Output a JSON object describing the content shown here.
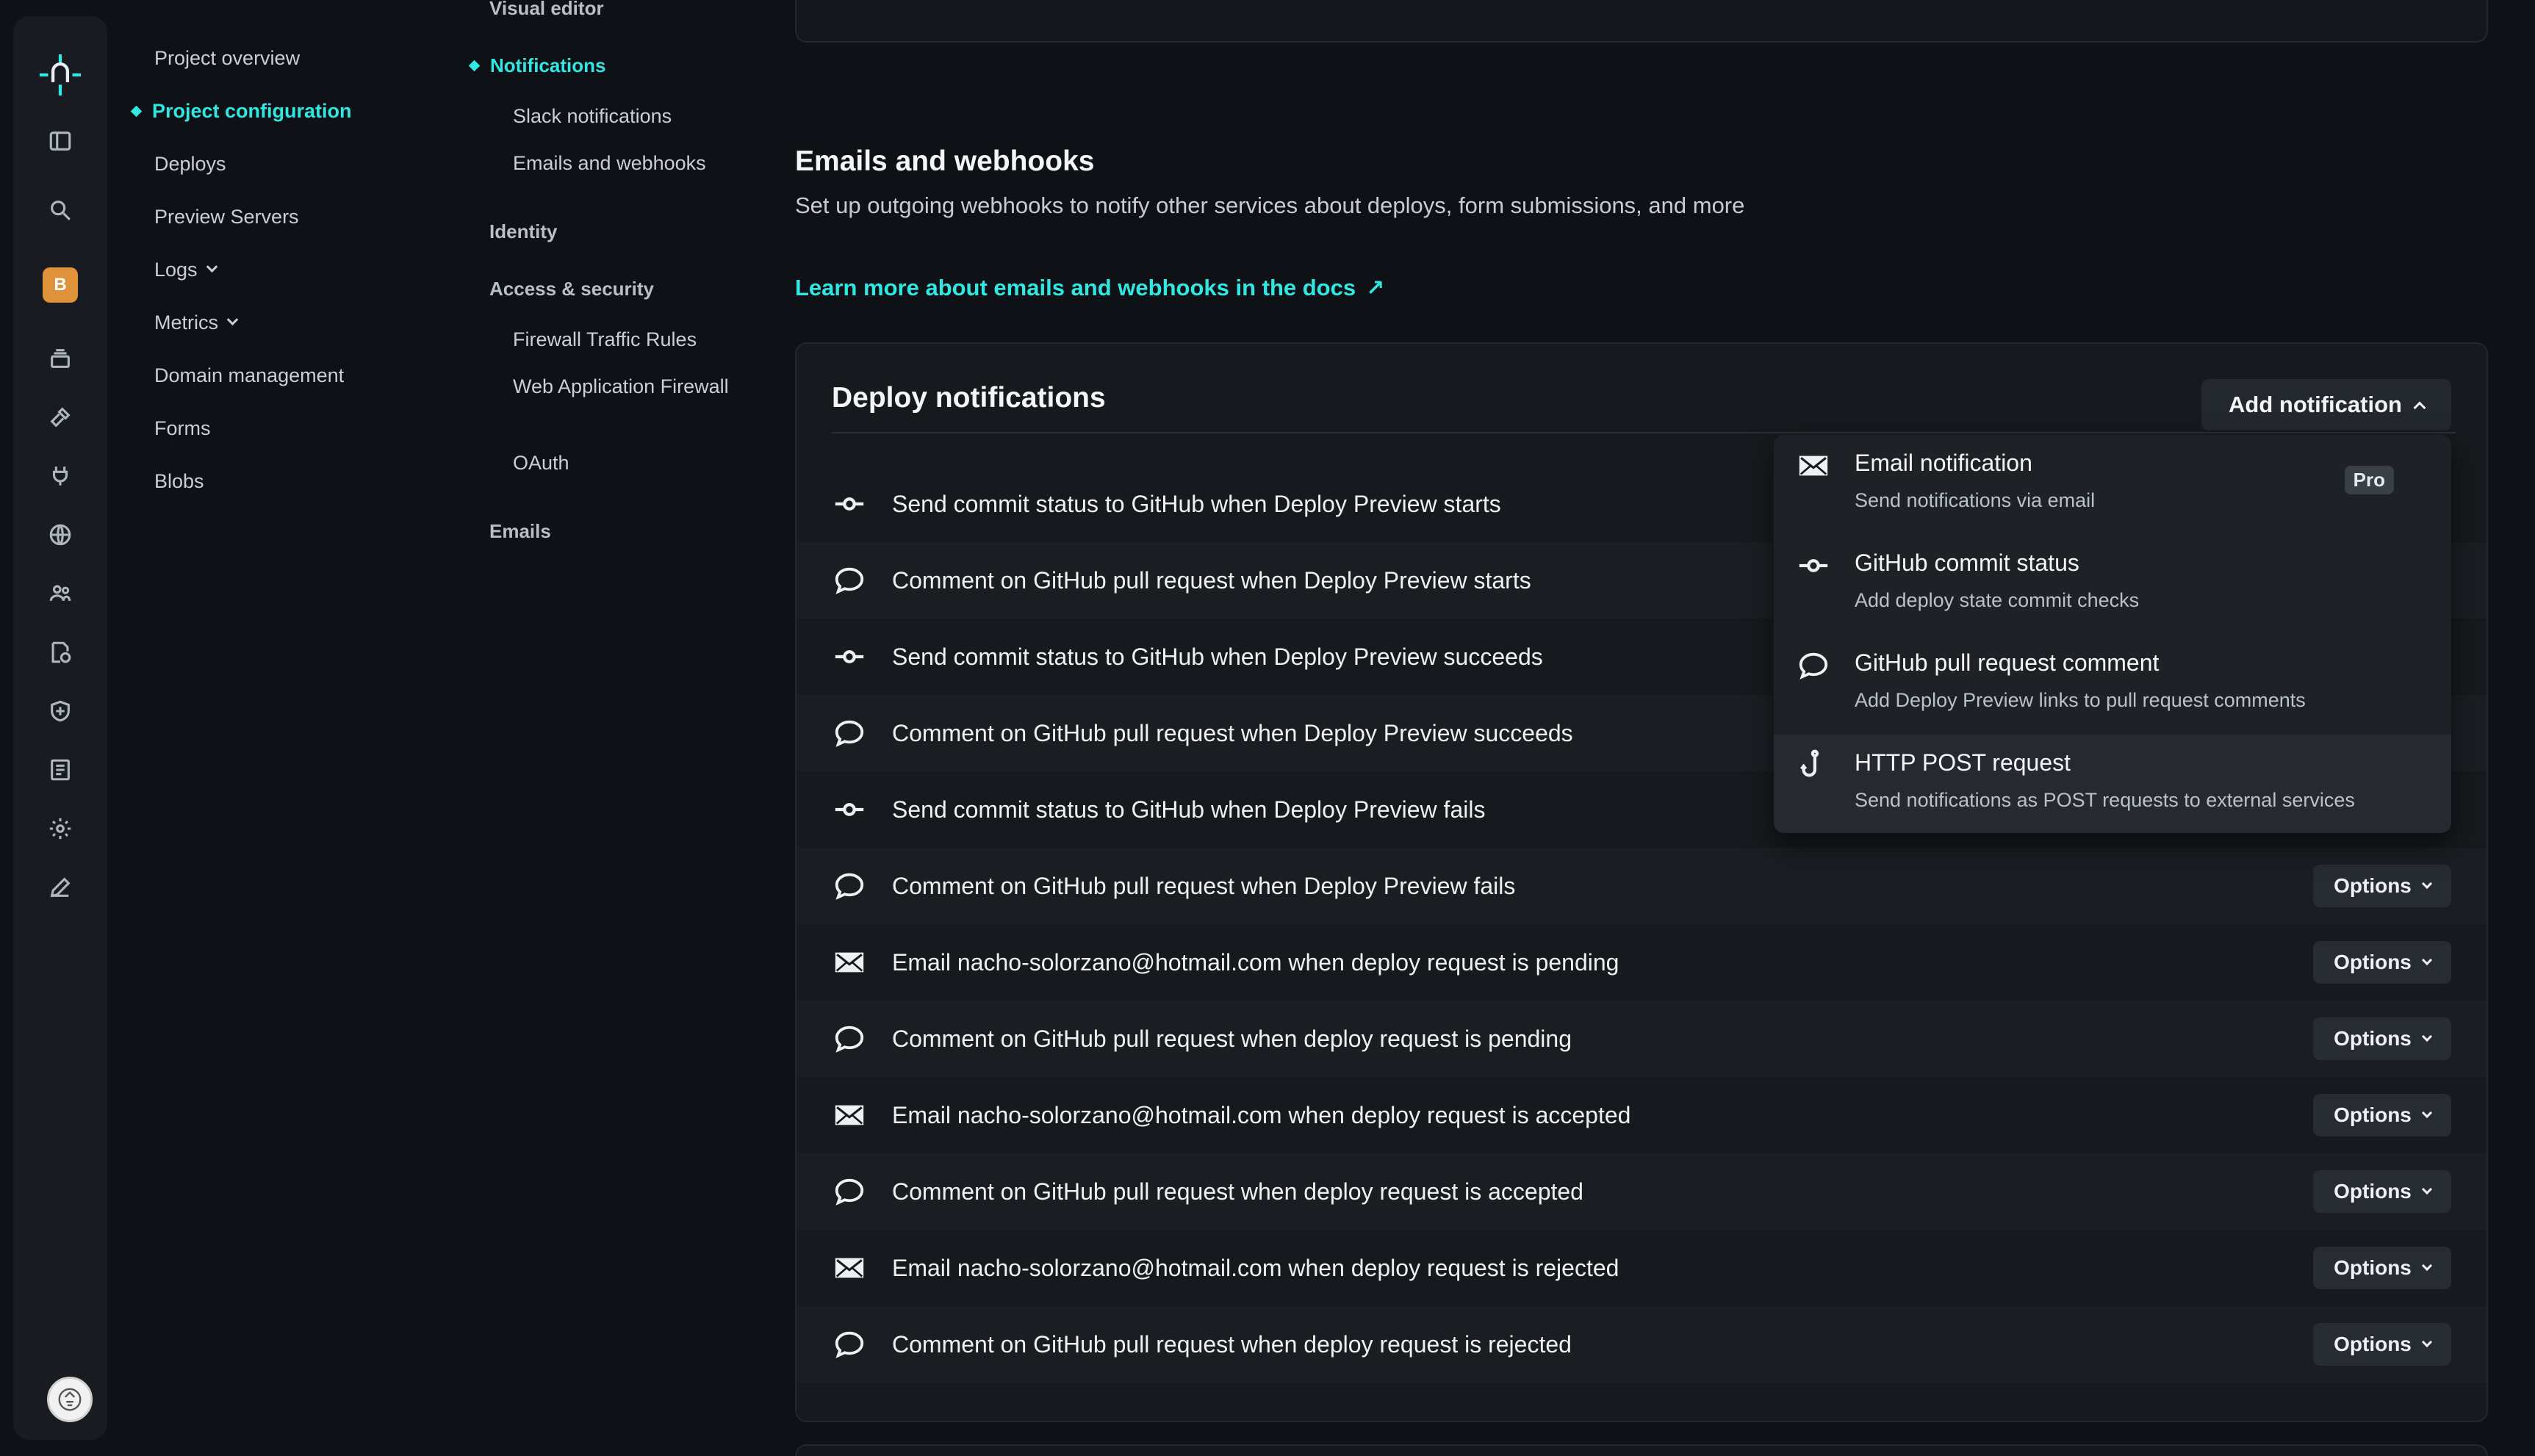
{
  "nav_primary": [
    {
      "label": "Project overview",
      "active": false,
      "chevron": false
    },
    {
      "label": "Project configuration",
      "active": true,
      "chevron": false
    },
    {
      "label": "Deploys",
      "active": false,
      "chevron": false
    },
    {
      "label": "Preview Servers",
      "active": false,
      "chevron": false
    },
    {
      "label": "Logs",
      "active": false,
      "chevron": true
    },
    {
      "label": "Metrics",
      "active": false,
      "chevron": true
    },
    {
      "label": "Domain management",
      "active": false,
      "chevron": false
    },
    {
      "label": "Forms",
      "active": false,
      "chevron": false
    },
    {
      "label": "Blobs",
      "active": false,
      "chevron": false
    }
  ],
  "nav_secondary": {
    "visual_editor": "Visual editor",
    "notifications": "Notifications",
    "slack": "Slack notifications",
    "emails_webhooks": "Emails and webhooks",
    "identity": "Identity",
    "access_security": "Access & security",
    "firewall": "Firewall Traffic Rules",
    "waf": "Web Application Firewall",
    "oauth": "OAuth",
    "emails": "Emails"
  },
  "team_badge": "B",
  "section": {
    "title": "Emails and webhooks",
    "description": "Set up outgoing webhooks to notify other services about deploys, form submissions, and more",
    "link": "Learn more about emails and webhooks in the docs",
    "link_arrow": "↗"
  },
  "card": {
    "title": "Deploy notifications",
    "add_button": "Add notification",
    "options_label": "Options"
  },
  "rows": [
    {
      "icon": "commit",
      "text": "Send commit status to GitHub when Deploy Preview starts",
      "has_options": false
    },
    {
      "icon": "comment",
      "text": "Comment on GitHub pull request when Deploy Preview starts",
      "has_options": false
    },
    {
      "icon": "commit",
      "text": "Send commit status to GitHub when Deploy Preview succeeds",
      "has_options": false
    },
    {
      "icon": "comment",
      "text": "Comment on GitHub pull request when Deploy Preview succeeds",
      "has_options": false
    },
    {
      "icon": "commit",
      "text": "Send commit status to GitHub when Deploy Preview fails",
      "has_options": false
    },
    {
      "icon": "comment",
      "text": "Comment on GitHub pull request when Deploy Preview fails",
      "has_options": true
    },
    {
      "icon": "email",
      "text": "Email nacho-solorzano@hotmail.com when deploy request is pending",
      "has_options": true
    },
    {
      "icon": "comment",
      "text": "Comment on GitHub pull request when deploy request is pending",
      "has_options": true
    },
    {
      "icon": "email",
      "text": "Email nacho-solorzano@hotmail.com when deploy request is accepted",
      "has_options": true
    },
    {
      "icon": "comment",
      "text": "Comment on GitHub pull request when deploy request is accepted",
      "has_options": true
    },
    {
      "icon": "email",
      "text": "Email nacho-solorzano@hotmail.com when deploy request is rejected",
      "has_options": true
    },
    {
      "icon": "comment",
      "text": "Comment on GitHub pull request when deploy request is rejected",
      "has_options": true
    }
  ],
  "dropdown": [
    {
      "icon": "email",
      "title": "Email notification",
      "desc": "Send notifications via email",
      "badge": "Pro"
    },
    {
      "icon": "commit",
      "title": "GitHub commit status",
      "desc": "Add deploy state commit checks",
      "badge": ""
    },
    {
      "icon": "comment",
      "title": "GitHub pull request comment",
      "desc": "Add Deploy Preview links to pull request comments",
      "badge": ""
    },
    {
      "icon": "hook",
      "title": "HTTP POST request",
      "desc": "Send notifications as POST requests to external services",
      "badge": ""
    }
  ],
  "colors": {
    "accent": "#32e6e2",
    "background": "#0e1216",
    "card": "#161a1e",
    "badge": "#e0923a"
  }
}
